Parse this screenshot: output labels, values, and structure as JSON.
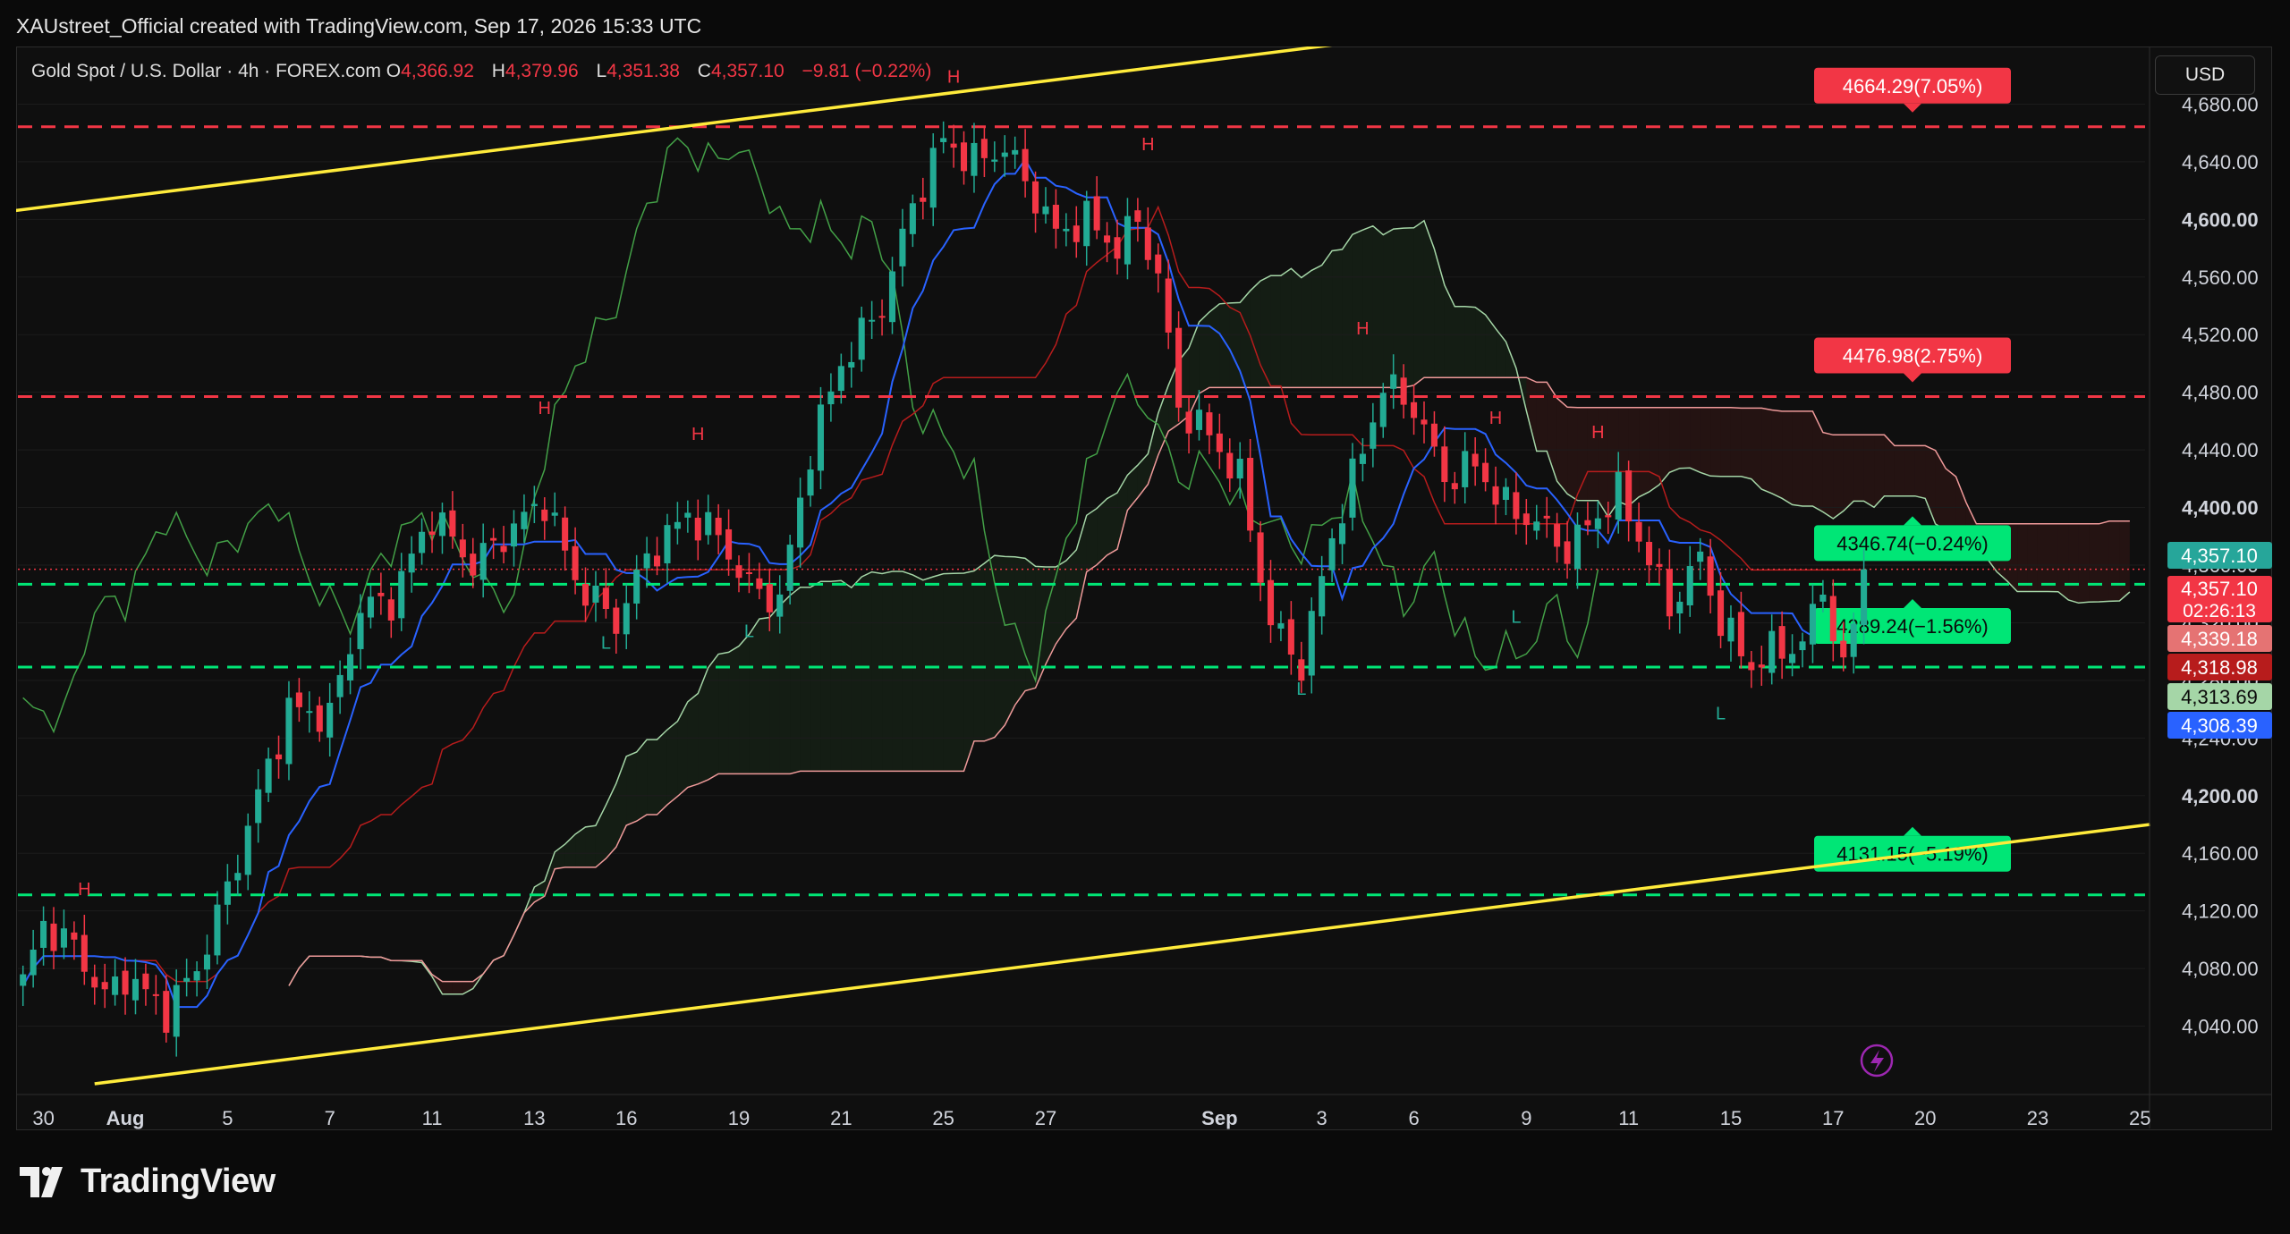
{
  "caption": "XAUstreet_Official created with TradingView.com, Sep 17, 2026 15:33 UTC",
  "legend": {
    "symbol": "Gold Spot / U.S. Dollar · 4h · FOREX.com",
    "open_label": "O",
    "open": "4,366.92",
    "high_label": "H",
    "high": "4,379.96",
    "low_label": "L",
    "low": "4,351.38",
    "close_label": "C",
    "close": "4,357.10",
    "change": "−9.81 (−0.22%)"
  },
  "currency": "USD",
  "footer_brand": "TradingView",
  "colors": {
    "bull": "#22ab94",
    "bear": "#f23645",
    "trend": "#ffeb3b",
    "resistance": "#f23645",
    "support": "#00e676",
    "tenkan": "#2962ff",
    "kijun": "#b71c1c",
    "chikou": "#43a047",
    "spanA": "#a5d6a7",
    "spanB": "#ef9a9a"
  },
  "chart_data": {
    "type": "candlestick",
    "ylim": [
      4000,
      4720
    ],
    "y_ticks": [
      4040,
      4080,
      4120,
      4160,
      4200,
      4240,
      4280,
      4320,
      4360,
      4400,
      4440,
      4480,
      4520,
      4560,
      4600,
      4640,
      4680
    ],
    "y_tick_labels": [
      "4,040.00",
      "4,080.00",
      "4,120.00",
      "4,160.00",
      "4,200.00",
      "4,240.00",
      "4,280.00",
      "4,320.00",
      "4,360.00",
      "4,400.00",
      "4,440.00",
      "4,480.00",
      "4,520.00",
      "4,560.00",
      "4,600.00",
      "4,640.00",
      "4,680.00"
    ],
    "x_labels": [
      {
        "label": "30",
        "i": 2
      },
      {
        "label": "Aug",
        "i": 10
      },
      {
        "label": "5",
        "i": 20
      },
      {
        "label": "7",
        "i": 30
      },
      {
        "label": "11",
        "i": 40
      },
      {
        "label": "13",
        "i": 50
      },
      {
        "label": "16",
        "i": 59
      },
      {
        "label": "19",
        "i": 70
      },
      {
        "label": "21",
        "i": 80
      },
      {
        "label": "25",
        "i": 90
      },
      {
        "label": "27",
        "i": 100
      },
      {
        "label": "Sep",
        "i": 117
      },
      {
        "label": "3",
        "i": 127
      },
      {
        "label": "6",
        "i": 136
      },
      {
        "label": "9",
        "i": 147
      },
      {
        "label": "11",
        "i": 157
      },
      {
        "label": "15",
        "i": 167
      },
      {
        "label": "17",
        "i": 177
      },
      {
        "label": "20",
        "i": 186
      },
      {
        "label": "23",
        "i": 197
      },
      {
        "label": "25",
        "i": 207
      }
    ],
    "total_slots": 208,
    "last_index": 180,
    "anchors": [
      [
        0,
        4070
      ],
      [
        2,
        4110
      ],
      [
        5,
        4095
      ],
      [
        8,
        4060
      ],
      [
        10,
        4075
      ],
      [
        14,
        4050
      ],
      [
        17,
        4080
      ],
      [
        20,
        4135
      ],
      [
        23,
        4200
      ],
      [
        26,
        4260
      ],
      [
        30,
        4255
      ],
      [
        33,
        4330
      ],
      [
        36,
        4335
      ],
      [
        40,
        4395
      ],
      [
        44,
        4360
      ],
      [
        47,
        4380
      ],
      [
        51,
        4405
      ],
      [
        54,
        4350
      ],
      [
        58,
        4320
      ],
      [
        61,
        4365
      ],
      [
        65,
        4395
      ],
      [
        68,
        4380
      ],
      [
        71,
        4345
      ],
      [
        74,
        4335
      ],
      [
        77,
        4440
      ],
      [
        80,
        4500
      ],
      [
        84,
        4540
      ],
      [
        87,
        4610
      ],
      [
        90,
        4655
      ],
      [
        93,
        4640
      ],
      [
        96,
        4650
      ],
      [
        99,
        4615
      ],
      [
        101,
        4590
      ],
      [
        104,
        4600
      ],
      [
        107,
        4580
      ],
      [
        109,
        4600
      ],
      [
        111,
        4560
      ],
      [
        113,
        4470
      ],
      [
        116,
        4450
      ],
      [
        119,
        4420
      ],
      [
        122,
        4320
      ],
      [
        125,
        4290
      ],
      [
        128,
        4380
      ],
      [
        131,
        4440
      ],
      [
        133,
        4485
      ],
      [
        136,
        4470
      ],
      [
        139,
        4420
      ],
      [
        142,
        4430
      ],
      [
        145,
        4400
      ],
      [
        148,
        4390
      ],
      [
        151,
        4370
      ],
      [
        154,
        4395
      ],
      [
        156,
        4410
      ],
      [
        158,
        4380
      ],
      [
        161,
        4330
      ],
      [
        164,
        4365
      ],
      [
        166,
        4320
      ],
      [
        169,
        4290
      ],
      [
        171,
        4300
      ],
      [
        174,
        4305
      ],
      [
        176,
        4345
      ],
      [
        178,
        4285
      ],
      [
        179,
        4320
      ],
      [
        180,
        4357.1
      ]
    ],
    "trendlines": [
      {
        "name": "upper-channel",
        "from": [
          -2,
          4605
        ],
        "to": [
          138,
          4730
        ]
      },
      {
        "name": "lower-channel",
        "from": [
          7,
          4000
        ],
        "to": [
          208,
          4180
        ]
      }
    ],
    "horizontal_levels": [
      {
        "price": 4664.29,
        "label": "4664.29(7.05%)",
        "kind": "resistance"
      },
      {
        "price": 4476.98,
        "label": "4476.98(2.75%)",
        "kind": "resistance"
      },
      {
        "price": 4346.74,
        "label": "4346.74(−0.24%)",
        "kind": "support"
      },
      {
        "price": 4289.24,
        "label": "4289.24(−1.56%)",
        "kind": "support"
      },
      {
        "price": 4131.15,
        "label": "4131.15(−5.19%)",
        "kind": "support"
      }
    ],
    "last_price_line": 4357.1,
    "price_tags": [
      {
        "price": 4357.1,
        "text": "4,357.10",
        "bg": "#26a69a",
        "fg": "#ffffff"
      },
      {
        "price": 4339.18,
        "text": "4,339.18",
        "bg": "#e57373",
        "fg": "#ffffff"
      },
      {
        "price": 4318.98,
        "text": "4,318.98",
        "bg": "#b71c1c",
        "fg": "#ffffff"
      },
      {
        "price": 4313.69,
        "text": "4,313.69",
        "bg": "#a5d6a7",
        "fg": "#0a0a0a"
      },
      {
        "price": 4308.39,
        "text": "4,308.39",
        "bg": "#2962ff",
        "fg": "#ffffff"
      }
    ],
    "current_tag": {
      "price": 4357.1,
      "text": "4,357.10",
      "countdown": "02:26:13",
      "bg": "#f23645"
    },
    "pivot_labels": [
      {
        "text": "H",
        "i": 6,
        "price": 4131
      },
      {
        "text": "H",
        "i": 51,
        "price": 4465
      },
      {
        "text": "H",
        "i": 66,
        "price": 4447
      },
      {
        "text": "L",
        "i": 57,
        "price": 4302
      },
      {
        "text": "L",
        "i": 71,
        "price": 4310
      },
      {
        "text": "H",
        "i": 91,
        "price": 4695
      },
      {
        "text": "H",
        "i": 110,
        "price": 4648
      },
      {
        "text": "L",
        "i": 125,
        "price": 4270
      },
      {
        "text": "H",
        "i": 131,
        "price": 4520
      },
      {
        "text": "H",
        "i": 144,
        "price": 4458
      },
      {
        "text": "L",
        "i": 146,
        "price": 4320
      },
      {
        "text": "H",
        "i": 154,
        "price": 4448
      },
      {
        "text": "L",
        "i": 166,
        "price": 4253
      }
    ]
  }
}
